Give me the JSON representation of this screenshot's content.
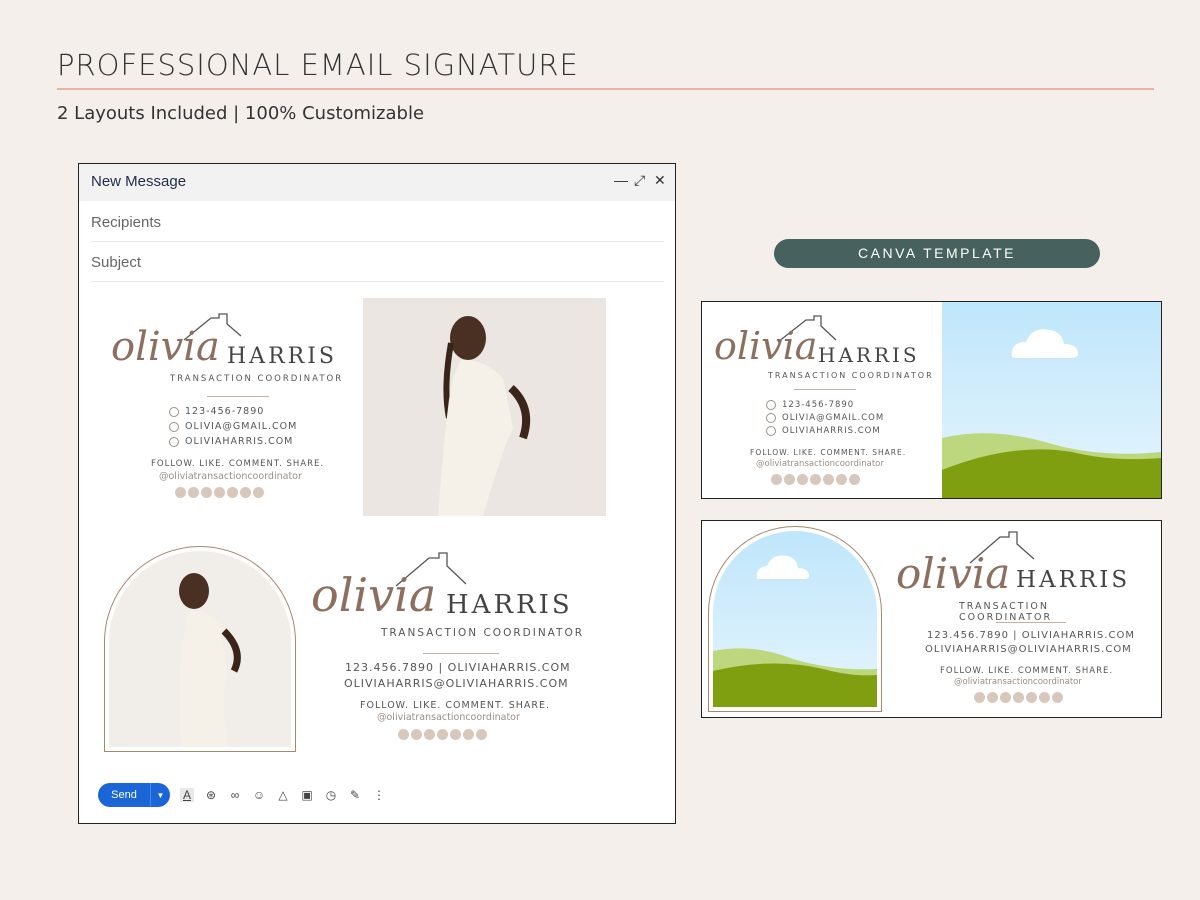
{
  "header": {
    "title": "PROFESSIONAL EMAIL SIGNATURE",
    "subtitle": "2 Layouts Included | 100% Customizable"
  },
  "colors": {
    "background": "#f4efeb",
    "accent_rule": "#e6b4a4",
    "canva_badge": "#47625e",
    "send_button": "#1a66d6",
    "brown_text": "#8c6f5e",
    "sky": "#d4edfb",
    "grass": "#7f9f11"
  },
  "email_window": {
    "title": "New Message",
    "controls": [
      "minimize-icon",
      "expand-icon",
      "close-icon"
    ],
    "recipients_placeholder": "Recipients",
    "subject_placeholder": "Subject",
    "send_label": "Send",
    "toolbar_icons": [
      "text-format-icon",
      "attach-icon",
      "link-icon",
      "emoji-icon",
      "drive-icon",
      "image-icon",
      "lock-clock-icon",
      "pen-icon",
      "more-icon"
    ]
  },
  "signature1": {
    "script_name": "olivia",
    "last_name": "HARRIS",
    "role": "TRANSACTION COORDINATOR",
    "phone": "123-456-7890",
    "email": "OLIVIA@GMAIL.COM",
    "website": "OLIVIAHARRIS.COM",
    "cta": "FOLLOW. LIKE. COMMENT. SHARE.",
    "handle": "@oliviatransactioncoordinator",
    "social_icons": [
      "instagram-icon",
      "facebook-icon",
      "youtube-icon",
      "tiktok-icon",
      "x-icon",
      "linkedin-icon",
      "pinterest-icon"
    ]
  },
  "signature2": {
    "script_name": "olivia",
    "last_name": "HARRIS",
    "role": "TRANSACTION COORDINATOR",
    "line1": "123.456.7890 | OLIVIAHARRIS.COM",
    "line2": "OLIVIAHARRIS@OLIVIAHARRIS.COM",
    "cta": "FOLLOW. LIKE. COMMENT. SHARE.",
    "handle": "@oliviatransactioncoordinator"
  },
  "canva": {
    "badge": "CANVA TEMPLATE",
    "template1": {
      "script_name": "olivia",
      "last_name": "HARRIS",
      "role": "TRANSACTION COORDINATOR",
      "phone": "123-456-7890",
      "email": "OLIVIA@GMAIL.COM",
      "website": "OLIVIAHARRIS.COM",
      "cta": "FOLLOW. LIKE. COMMENT. SHARE.",
      "handle": "@oliviatransactioncoordinator"
    },
    "template2": {
      "script_name": "olivia",
      "last_name": "HARRIS",
      "role": "TRANSACTION COORDINATOR",
      "line1": "123.456.7890 | OLIVIAHARRIS.COM",
      "line2": "OLIVIAHARRIS@OLIVIAHARRIS.COM",
      "cta": "FOLLOW. LIKE. COMMENT. SHARE.",
      "handle": "@oliviatransactioncoordinator"
    }
  }
}
